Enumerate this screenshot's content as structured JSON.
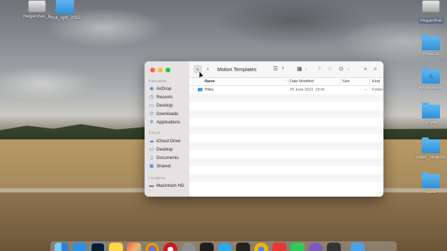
{
  "desktop": {
    "left_icons": [
      {
        "label": "megarohas_lc",
        "kind": "drive"
      },
      {
        "label": "msk_spb_2022",
        "kind": "folder"
      }
    ],
    "right_icons": [
      {
        "label": "megarohas",
        "kind": "drive",
        "selected": true
      },
      {
        "label": "Projects",
        "kind": "folder"
      },
      {
        "label": "Applications",
        "kind": "folder",
        "glyph": "A"
      },
      {
        "label": "штуки",
        "kind": "folder"
      },
      {
        "label": "video_projects",
        "kind": "folder"
      },
      {
        "label": "work",
        "kind": "folder"
      }
    ]
  },
  "finder": {
    "title": "Motion Templates",
    "sidebar": {
      "favourites_heading": "Favourites",
      "favourites": [
        {
          "label": "AirDrop",
          "icon": "airdrop-icon"
        },
        {
          "label": "Recents",
          "icon": "clock-icon"
        },
        {
          "label": "Desktop",
          "icon": "desktop-icon"
        },
        {
          "label": "Downloads",
          "icon": "download-icon"
        },
        {
          "label": "Applications",
          "icon": "applications-icon"
        }
      ],
      "icloud_heading": "iCloud",
      "icloud": [
        {
          "label": "iCloud Drive",
          "icon": "cloud-icon"
        },
        {
          "label": "Desktop",
          "icon": "desktop-icon"
        },
        {
          "label": "Documents",
          "icon": "document-icon"
        },
        {
          "label": "Shared",
          "icon": "shared-icon"
        }
      ],
      "locations_heading": "Locations",
      "locations": [
        {
          "label": "Macintosh HD",
          "icon": "disk-icon"
        }
      ]
    },
    "columns": {
      "name": "Name",
      "date": "Date Modified",
      "size": "Size",
      "kind": "Kind"
    },
    "files": [
      {
        "name": "Titles",
        "date": "29 June 2022, 18:41",
        "size": "--",
        "kind": "Folder"
      }
    ],
    "toolbar": {
      "back": "‹",
      "forward": "›",
      "list_view": "☰",
      "grid_view": "▦",
      "share": "⇪",
      "tag": "◇",
      "more": "⊙",
      "expand": "»",
      "search": "⌕"
    }
  },
  "dock": {
    "apps": [
      "finder",
      "mail",
      "photoshop",
      "notes",
      "launchpad",
      "chrome",
      "opera",
      "system-prefs",
      "terminal",
      "telegram",
      "unity",
      "chrome-canary",
      "pdf",
      "numbers",
      "safari-like",
      "final-cut",
      "folder"
    ]
  },
  "colors": {
    "folder_blue": "#2f8fd8",
    "accent": "#3a7bd5"
  }
}
